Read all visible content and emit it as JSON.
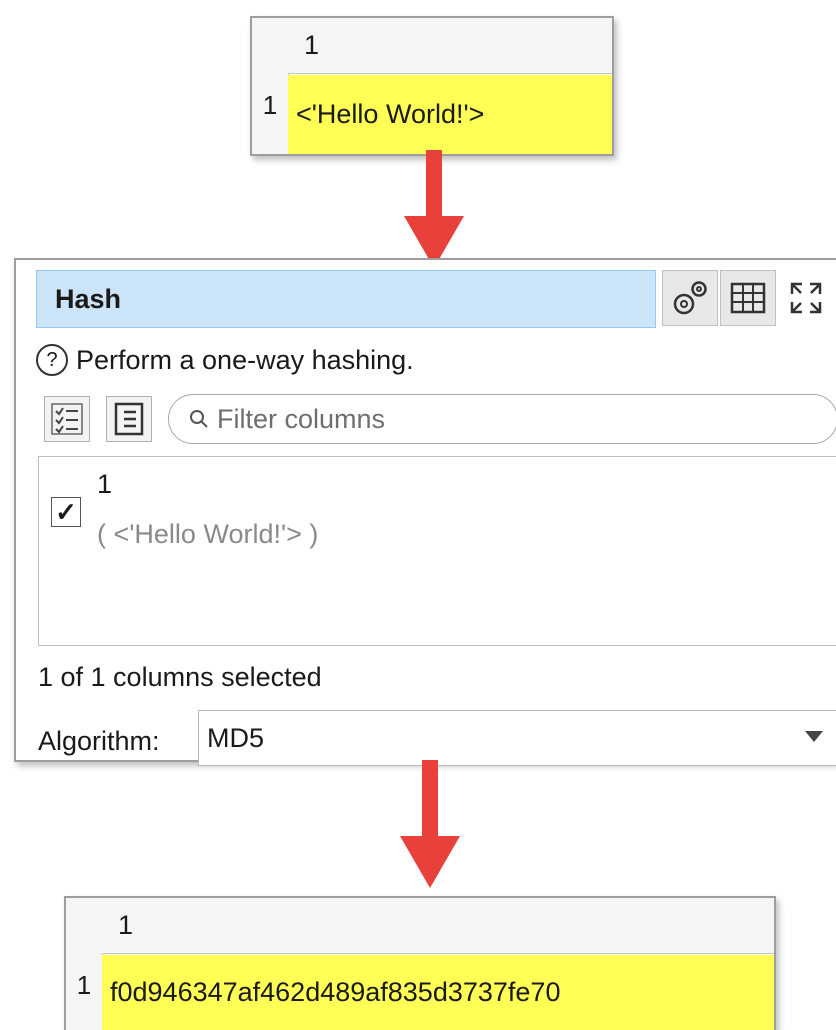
{
  "input_table": {
    "column_header": "1",
    "row_number": "1",
    "cell_value": "<'Hello World!'>"
  },
  "hash_panel": {
    "title": "Hash",
    "description": "Perform a one-way hashing.",
    "filter_placeholder": "Filter columns",
    "column": {
      "name": "1",
      "sample": "( <'Hello World!'> )",
      "checked": true,
      "check_glyph": "✓"
    },
    "status": "1 of 1 columns selected",
    "algorithm_label": "Algorithm:",
    "algorithm_value": "MD5",
    "help_glyph": "?"
  },
  "output_table": {
    "column_header": "1",
    "row_number": "1",
    "cell_value": "f0d946347af462d489af835d3737fe70"
  },
  "colors": {
    "highlight": "#ffff55",
    "arrow": "#e8403a",
    "title_bar": "#cce4f7"
  }
}
